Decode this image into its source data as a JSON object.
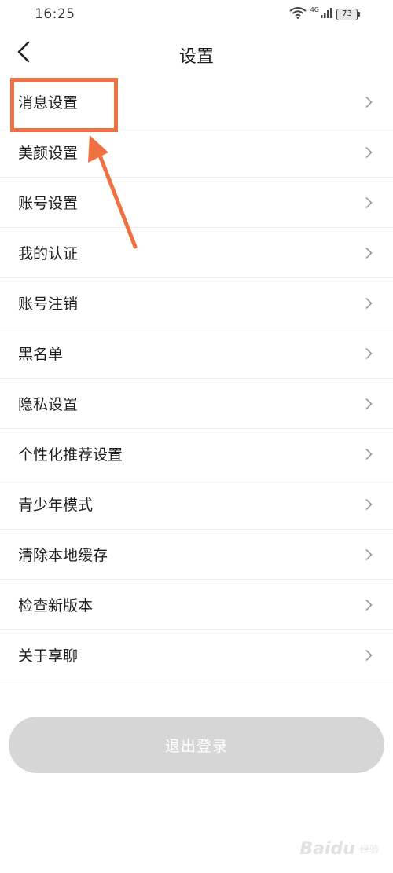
{
  "status_bar": {
    "time": "16:25",
    "network": "4G",
    "battery": "73",
    "icons": [
      "wifi-icon",
      "signal-icon",
      "battery-icon"
    ]
  },
  "header": {
    "back_icon": "chevron-left-icon",
    "title": "设置"
  },
  "settings": {
    "items": [
      {
        "label": "消息设置"
      },
      {
        "label": "美颜设置"
      },
      {
        "label": "账号设置"
      },
      {
        "label": "我的认证"
      },
      {
        "label": "账号注销"
      },
      {
        "label": "黑名单"
      },
      {
        "label": "隐私设置"
      },
      {
        "label": "个性化推荐设置"
      },
      {
        "label": "青少年模式"
      },
      {
        "label": "清除本地缓存"
      },
      {
        "label": "检查新版本"
      },
      {
        "label": "关于享聊"
      }
    ],
    "chevron_icon": "chevron-right-icon"
  },
  "logout": {
    "label": "退出登录"
  },
  "colors": {
    "highlight": "#ef7040",
    "logout_bg": "#d6d6d6",
    "divider": "#ececec"
  },
  "watermark": {
    "text": "Baidu",
    "sub": "经验"
  }
}
